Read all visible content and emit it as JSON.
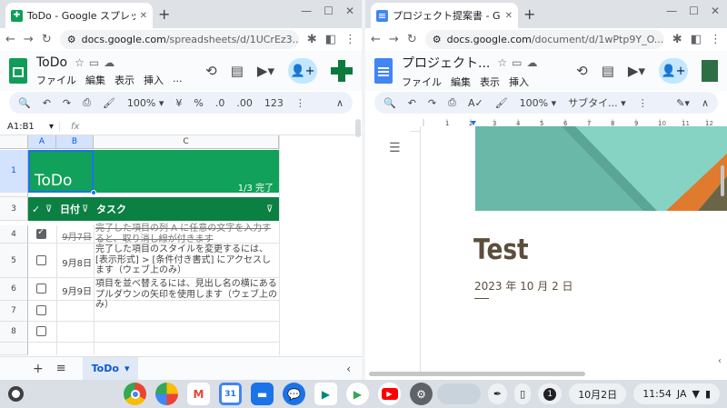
{
  "left_window": {
    "tab_title": "ToDo - Google スプレッドシ",
    "url_domain": "docs.google.com",
    "url_path": "/spreadsheets/d/1UCrEz3...",
    "doc_title": "ToDo",
    "menus": [
      "ファイル",
      "編集",
      "表示",
      "挿入",
      "..."
    ],
    "toolbar": {
      "zoom": "100%",
      "currency": "¥",
      "percent": "%",
      "decimal_dec": ".0",
      "decimal_inc": ".00",
      "number_format": "123"
    },
    "name_box": "A1:B1",
    "fx": "fx",
    "columns": [
      "A",
      "B",
      "C"
    ],
    "rows": [
      "1",
      "2",
      "3",
      "4",
      "5",
      "6",
      "7",
      "8"
    ],
    "banner_title": "ToDo",
    "banner_count": "1/3 完了",
    "header": {
      "check": "✓",
      "date": "日付",
      "task": "タスク"
    },
    "tasks": [
      {
        "checked": true,
        "date": "9月7日",
        "text": "完了した項目の列 A に任意の文字を入力すると、取り消し線が付きます"
      },
      {
        "checked": false,
        "date": "9月8日",
        "text": "完了した項目のスタイルを変更するには、[表示形式] > [条件付き書式] にアクセスします（ウェブ上のみ）"
      },
      {
        "checked": false,
        "date": "9月9日",
        "text": "項目を並べ替えるには、見出し名の横にあるプルダウンの矢印を使用します（ウェブ上のみ）"
      }
    ],
    "sheet_tab": "ToDo"
  },
  "right_window": {
    "tab_title": "プロジェクト提案書 - Google",
    "url_domain": "docs.google.com",
    "url_path": "/document/d/1wPtp9Y_O...",
    "doc_title": "プロジェクト...",
    "menus": [
      "ファイル",
      "編集",
      "表示",
      "挿入"
    ],
    "toolbar": {
      "zoom": "100%",
      "style": "サブタイ..."
    },
    "ruler_ticks": [
      "1",
      "2",
      "3",
      "4",
      "5",
      "6",
      "7",
      "8",
      "9",
      "10",
      "11",
      "12"
    ],
    "page_title": "Test",
    "page_date": "2023 年 10 月 2 日"
  },
  "shelf": {
    "apps": [
      "Chrome",
      "Photos",
      "Gmail",
      "Calendar",
      "Files",
      "Messages",
      "Meet",
      "Play",
      "YouTube",
      "Settings"
    ],
    "notification_count": "1",
    "date": "10月2日",
    "time": "11:54",
    "ime": "JA"
  },
  "colors": {
    "sheet_green": "#11a15a",
    "header_green": "#0c8043",
    "docs_blue": "#4285f4",
    "doc_text": "#5b4e3c"
  }
}
